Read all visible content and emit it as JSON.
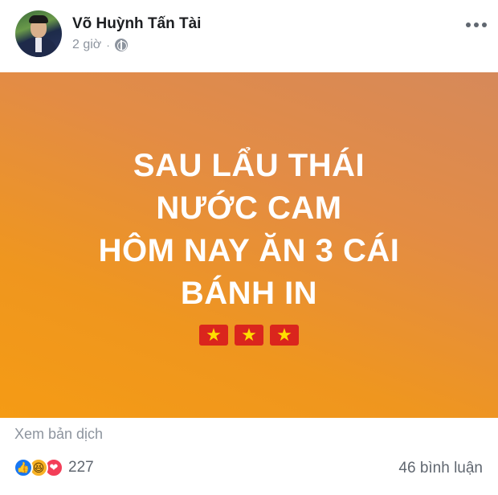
{
  "post": {
    "author_name": "Võ Huỳnh Tấn Tài",
    "time": "2 giờ",
    "separator": "·",
    "privacy_icon": "globe-icon",
    "more_icon": "more-options-icon",
    "avatar": "avatar"
  },
  "banner": {
    "background": "#f0941f",
    "text_color": "#ffffff",
    "lines": [
      "SAU LẨU THÁI",
      "NƯỚC CAM",
      "HÔM NAY ĂN 3 CÁI",
      "BÁNH IN"
    ],
    "flag_icon": "vietnam-flag-icon",
    "flag_count": 3,
    "star": "★"
  },
  "footer": {
    "translate_label": "Xem bản dịch",
    "reaction_icons": [
      "like-icon",
      "haha-icon",
      "love-icon"
    ],
    "reaction_glyphs": [
      "👍",
      "😆",
      "❤"
    ],
    "reaction_count": "227",
    "comments_label": "46 bình luận"
  },
  "colors": {
    "like": "#1877f2",
    "haha": "#f7b125",
    "love": "#f33e58",
    "secondary_text": "#8d949e"
  }
}
